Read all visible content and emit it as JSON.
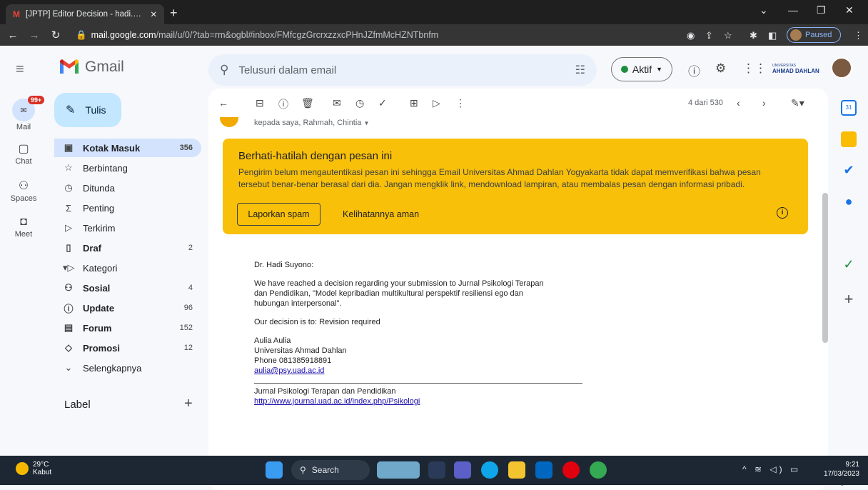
{
  "browser": {
    "tab_title": "[JPTP] Editor Decision - hadi.suyono",
    "url_host": "mail.google.com",
    "url_path": "/mail/u/0/?tab=rm&ogbl#inbox/FMfcgzGrcrxzzxcPHnJZfmMcHZNTbnfm",
    "profile_status": "Paused"
  },
  "header": {
    "app_name": "Gmail",
    "search_placeholder": "Telusuri dalam email",
    "status_label": "Aktif",
    "org_line1": "UNIVERSITAS",
    "org_line2": "AHMAD DAHLAN"
  },
  "rail": {
    "mail_badge": "99+",
    "items": [
      "Mail",
      "Chat",
      "Spaces",
      "Meet"
    ]
  },
  "sidebar": {
    "compose": "Tulis",
    "items": [
      {
        "label": "Kotak Masuk",
        "count": "356"
      },
      {
        "label": "Berbintang",
        "count": ""
      },
      {
        "label": "Ditunda",
        "count": ""
      },
      {
        "label": "Penting",
        "count": ""
      },
      {
        "label": "Terkirim",
        "count": ""
      },
      {
        "label": "Draf",
        "count": "2"
      },
      {
        "label": "Kategori",
        "count": ""
      },
      {
        "label": "Sosial",
        "count": "4"
      },
      {
        "label": "Update",
        "count": "96"
      },
      {
        "label": "Forum",
        "count": "152"
      },
      {
        "label": "Promosi",
        "count": "12"
      },
      {
        "label": "Selengkapnya",
        "count": ""
      }
    ],
    "labels_header": "Label"
  },
  "toolbar": {
    "pagination": "4 dari 530"
  },
  "message": {
    "recipients": "kepada saya, Rahmah, Chintia",
    "warning_title": "Berhati-hatilah dengan pesan ini",
    "warning_text": "Pengirim belum mengautentikasi pesan ini sehingga Email Universitas Ahmad Dahlan Yogyakarta tidak dapat memverifikasi bahwa pesan tersebut benar-benar berasal dari dia. Jangan mengklik link, mendownload lampiran, atau membalas pesan dengan informasi pribadi.",
    "report_spam": "Laporkan spam",
    "looks_safe": "Kelihatannya aman",
    "greeting": "Dr. Hadi Suyono:",
    "para1": "We have reached a decision regarding your submission to Jurnal Psikologi Terapan dan Pendidikan, \"Model kepribadian multikultural  perspektif resiliensi ego dan hubungan interpersonal\".",
    "decision": "Our decision is to: Revision required",
    "sig_name": "Aulia Aulia",
    "sig_org": "Universitas Ahmad Dahlan",
    "sig_phone": "Phone 081385918891",
    "sig_email": "aulia@psy.uad.ac.id",
    "journal_name": "Jurnal Psikologi Terapan dan Pendidikan",
    "journal_url": "http://www.journal.uad.ac.id/index.php/Psikologi"
  },
  "taskbar": {
    "temp": "29°C",
    "weather": "Kabut",
    "search": "Search",
    "time": "9:21",
    "date": "17/03/2023"
  },
  "colors": {
    "warning_bg": "#f9c00a",
    "active_nav": "#d3e3fd",
    "compose_bg": "#c2e7ff"
  }
}
